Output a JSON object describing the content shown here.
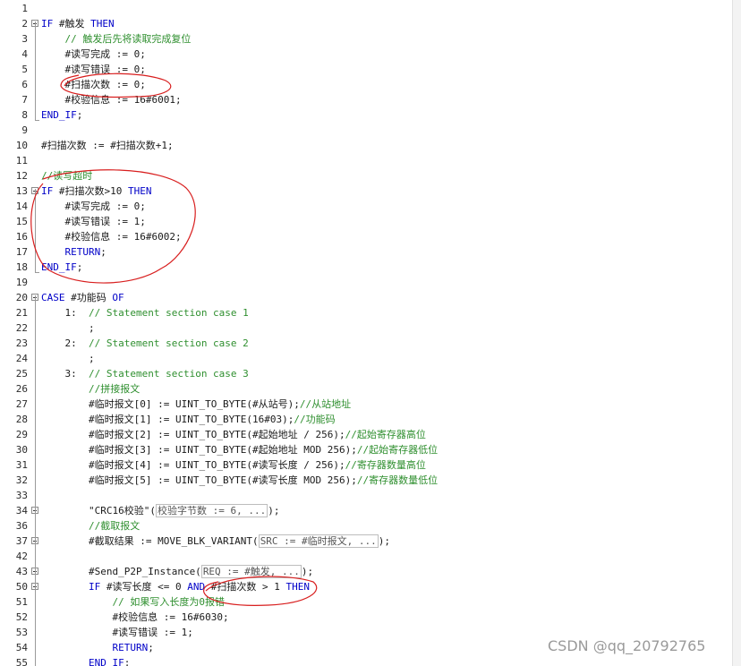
{
  "editor": {
    "lines": [
      {
        "n": "1",
        "code": []
      },
      {
        "n": "2",
        "fold": "minus",
        "code": [
          [
            "kw",
            "IF "
          ],
          [
            "t",
            "#触发 "
          ],
          [
            "kw",
            "THEN"
          ]
        ]
      },
      {
        "n": "3",
        "code": [
          [
            "t",
            "    "
          ],
          [
            "cm",
            "// 触发后先将读取完成复位"
          ]
        ]
      },
      {
        "n": "4",
        "code": [
          [
            "t",
            "    #读写完成 := 0;"
          ]
        ]
      },
      {
        "n": "5",
        "code": [
          [
            "t",
            "    #读写错误 := 0;"
          ]
        ]
      },
      {
        "n": "6",
        "code": [
          [
            "t",
            "    #扫描次数 := 0;"
          ]
        ]
      },
      {
        "n": "7",
        "code": [
          [
            "t",
            "    #校验信息 := 16#6001;"
          ]
        ]
      },
      {
        "n": "8",
        "code": [
          [
            "kw",
            "END_IF"
          ],
          [
            "t",
            ";"
          ]
        ]
      },
      {
        "n": "9",
        "code": []
      },
      {
        "n": "10",
        "code": [
          [
            "t",
            "#扫描次数 := #扫描次数+1;"
          ]
        ]
      },
      {
        "n": "11",
        "code": []
      },
      {
        "n": "12",
        "code": [
          [
            "cm",
            "//读写超时"
          ]
        ]
      },
      {
        "n": "13",
        "fold": "minus",
        "code": [
          [
            "kw",
            "IF "
          ],
          [
            "t",
            "#扫描次数>10 "
          ],
          [
            "kw",
            "THEN"
          ]
        ]
      },
      {
        "n": "14",
        "code": [
          [
            "t",
            "    #读写完成 := 0;"
          ]
        ]
      },
      {
        "n": "15",
        "code": [
          [
            "t",
            "    #读写错误 := 1;"
          ]
        ]
      },
      {
        "n": "16",
        "code": [
          [
            "t",
            "    #校验信息 := 16#6002;"
          ]
        ]
      },
      {
        "n": "17",
        "code": [
          [
            "t",
            "    "
          ],
          [
            "kw",
            "RETURN"
          ],
          [
            "t",
            ";"
          ]
        ]
      },
      {
        "n": "18",
        "code": [
          [
            "kw",
            "END_IF"
          ],
          [
            "t",
            ";"
          ]
        ]
      },
      {
        "n": "19",
        "code": []
      },
      {
        "n": "20",
        "fold": "minus",
        "code": [
          [
            "kw",
            "CASE "
          ],
          [
            "t",
            "#功能码 "
          ],
          [
            "kw",
            "OF"
          ]
        ]
      },
      {
        "n": "21",
        "code": [
          [
            "t",
            "    1:  "
          ],
          [
            "cm",
            "// Statement section case 1"
          ]
        ]
      },
      {
        "n": "22",
        "code": [
          [
            "t",
            "        ;"
          ]
        ]
      },
      {
        "n": "23",
        "code": [
          [
            "t",
            "    2:  "
          ],
          [
            "cm",
            "// Statement section case 2"
          ]
        ]
      },
      {
        "n": "24",
        "code": [
          [
            "t",
            "        ;"
          ]
        ]
      },
      {
        "n": "25",
        "code": [
          [
            "t",
            "    3:  "
          ],
          [
            "cm",
            "// Statement section case 3"
          ]
        ]
      },
      {
        "n": "26",
        "code": [
          [
            "t",
            "        "
          ],
          [
            "cm",
            "//拼接报文"
          ]
        ]
      },
      {
        "n": "27",
        "code": [
          [
            "t",
            "        #临时报文[0] := UINT_TO_BYTE(#从站号);"
          ],
          [
            "cm",
            "//从站地址"
          ]
        ]
      },
      {
        "n": "28",
        "code": [
          [
            "t",
            "        #临时报文[1] := UINT_TO_BYTE(16#03);"
          ],
          [
            "cm",
            "//功能码"
          ]
        ]
      },
      {
        "n": "29",
        "code": [
          [
            "t",
            "        #临时报文[2] := UINT_TO_BYTE(#起始地址 / 256);"
          ],
          [
            "cm",
            "//起始寄存器高位"
          ]
        ]
      },
      {
        "n": "30",
        "code": [
          [
            "t",
            "        #临时报文[3] := UINT_TO_BYTE(#起始地址 MOD 256);"
          ],
          [
            "cm",
            "//起始寄存器低位"
          ]
        ]
      },
      {
        "n": "31",
        "code": [
          [
            "t",
            "        #临时报文[4] := UINT_TO_BYTE(#读写长度 / 256);"
          ],
          [
            "cm",
            "//寄存器数量高位"
          ]
        ]
      },
      {
        "n": "32",
        "code": [
          [
            "t",
            "        #临时报文[5] := UINT_TO_BYTE(#读写长度 MOD 256);"
          ],
          [
            "cm",
            "//寄存器数量低位"
          ]
        ]
      },
      {
        "n": "33",
        "code": []
      },
      {
        "n": "34",
        "fold": "plus",
        "code": [
          [
            "t",
            "        \"CRC16校验\"("
          ],
          [
            "box",
            "校验字节数 := 6, ..."
          ],
          [
            "t",
            ");"
          ]
        ]
      },
      {
        "n": "36",
        "code": [
          [
            "t",
            "        "
          ],
          [
            "cm",
            "//截取报文"
          ]
        ]
      },
      {
        "n": "37",
        "fold": "plus",
        "code": [
          [
            "t",
            "        #截取结果 := MOVE_BLK_VARIANT("
          ],
          [
            "box",
            "SRC := #临时报文, ..."
          ],
          [
            "t",
            ");"
          ]
        ]
      },
      {
        "n": "42",
        "code": []
      },
      {
        "n": "43",
        "fold": "plus",
        "code": [
          [
            "t",
            "        #Send_P2P_Instance("
          ],
          [
            "box",
            "REQ := #触发, ..."
          ],
          [
            "t",
            ");"
          ]
        ]
      },
      {
        "n": "50",
        "fold": "minus",
        "code": [
          [
            "t",
            "        "
          ],
          [
            "kw",
            "IF "
          ],
          [
            "t",
            "#读写长度 <= 0 "
          ],
          [
            "kw",
            "AND "
          ],
          [
            "t",
            "#扫描次数 > 1 "
          ],
          [
            "kw",
            "THEN"
          ]
        ]
      },
      {
        "n": "51",
        "code": [
          [
            "t",
            "            "
          ],
          [
            "cm",
            "// 如果写入长度为0报错"
          ]
        ]
      },
      {
        "n": "52",
        "code": [
          [
            "t",
            "            #校验信息 := 16#6030;"
          ]
        ]
      },
      {
        "n": "53",
        "code": [
          [
            "t",
            "            #读写错误 := 1;"
          ]
        ]
      },
      {
        "n": "54",
        "code": [
          [
            "t",
            "            "
          ],
          [
            "kw",
            "RETURN"
          ],
          [
            "t",
            ";"
          ]
        ]
      },
      {
        "n": "55",
        "code": [
          [
            "t",
            "        "
          ],
          [
            "kw",
            "END_IF"
          ],
          [
            "t",
            ";"
          ]
        ]
      }
    ]
  },
  "watermark": "CSDN @qq_20792765",
  "colors": {
    "keyword": "#0000c8",
    "comment": "#2f8f2f",
    "annotation": "#d81e1e"
  }
}
